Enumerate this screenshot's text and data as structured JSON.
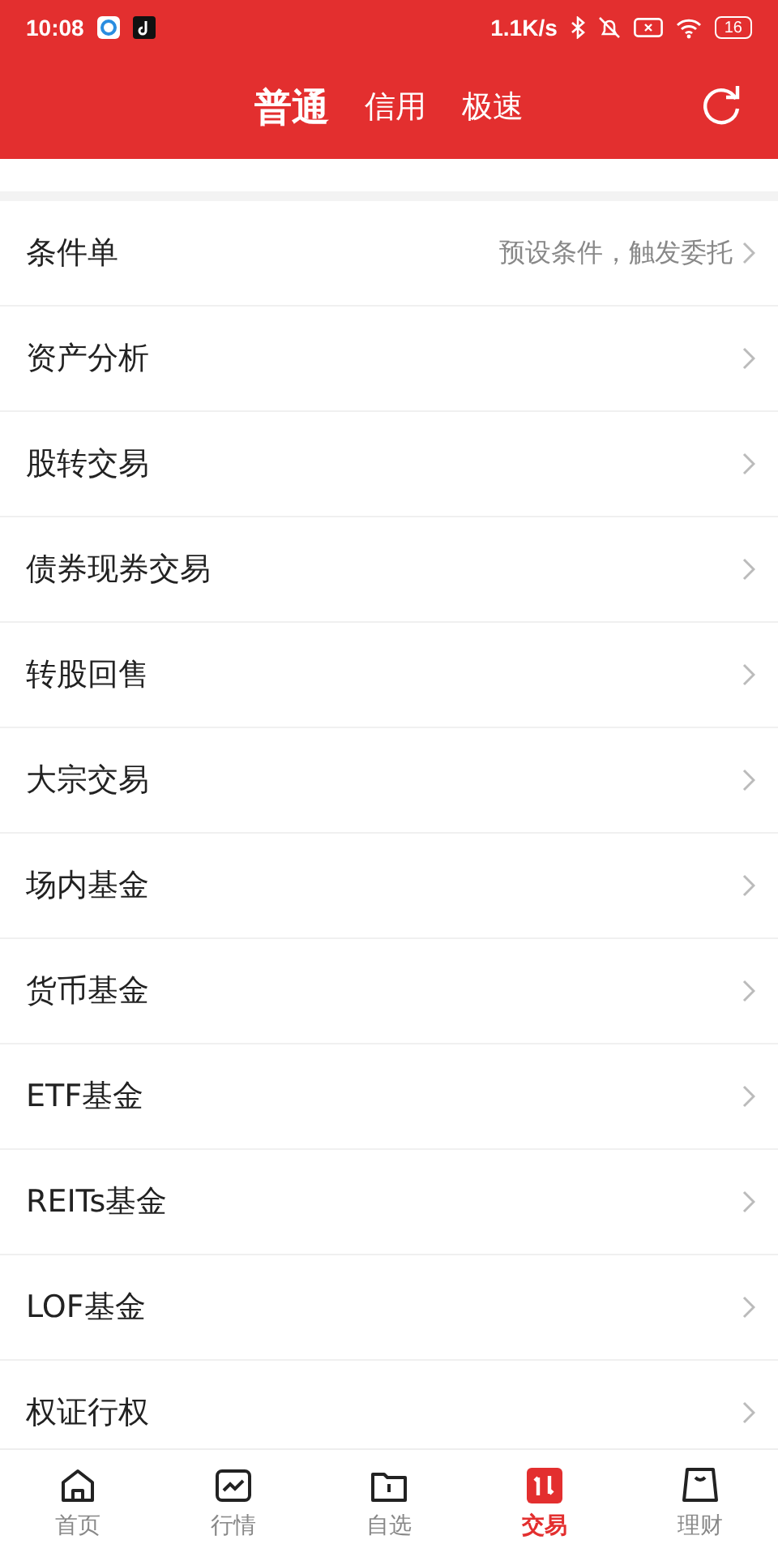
{
  "status_bar": {
    "time": "10:08",
    "net_speed": "1.1K/s",
    "battery": "16"
  },
  "header": {
    "tabs": [
      {
        "label": "普通",
        "selected": true
      },
      {
        "label": "信用",
        "selected": false
      },
      {
        "label": "极速",
        "selected": false
      }
    ]
  },
  "menu": [
    {
      "label": "条件单",
      "hint": "预设条件，触发委托"
    },
    {
      "label": "资产分析"
    },
    {
      "label": "股转交易"
    },
    {
      "label": "债券现券交易"
    },
    {
      "label": "转股回售"
    },
    {
      "label": "大宗交易"
    },
    {
      "label": "场内基金"
    },
    {
      "label": "货币基金"
    },
    {
      "label": "ETF基金"
    },
    {
      "label": "REITs基金"
    },
    {
      "label": "LOF基金"
    },
    {
      "label": "权证行权"
    }
  ],
  "bottom_nav": [
    {
      "label": "首页",
      "kind": "home",
      "selected": false
    },
    {
      "label": "行情",
      "kind": "chart",
      "selected": false
    },
    {
      "label": "自选",
      "kind": "folder",
      "selected": false
    },
    {
      "label": "交易",
      "kind": "trade",
      "selected": true
    },
    {
      "label": "理财",
      "kind": "bag",
      "selected": false
    }
  ]
}
